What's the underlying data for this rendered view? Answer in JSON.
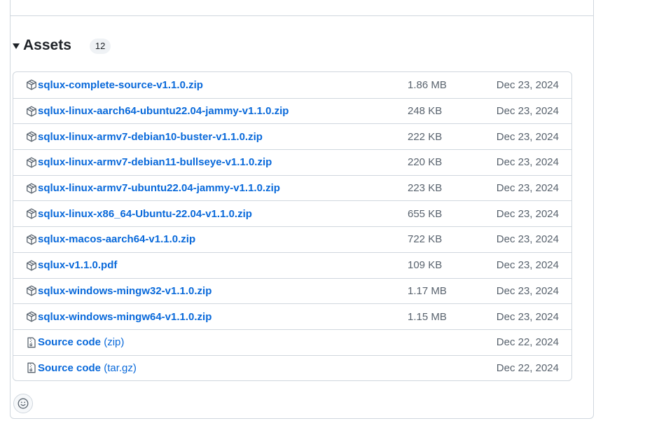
{
  "assets": {
    "title": "Assets",
    "count": "12",
    "items": [
      {
        "icon": "package-icon",
        "name": "sqlux-complete-source-v1.1.0.zip",
        "size": "1.86 MB",
        "date": "Dec 23, 2024"
      },
      {
        "icon": "package-icon",
        "name": "sqlux-linux-aarch64-ubuntu22.04-jammy-v1.1.0.zip",
        "size": "248 KB",
        "date": "Dec 23, 2024"
      },
      {
        "icon": "package-icon",
        "name": "sqlux-linux-armv7-debian10-buster-v1.1.0.zip",
        "size": "222 KB",
        "date": "Dec 23, 2024"
      },
      {
        "icon": "package-icon",
        "name": "sqlux-linux-armv7-debian11-bullseye-v1.1.0.zip",
        "size": "220 KB",
        "date": "Dec 23, 2024"
      },
      {
        "icon": "package-icon",
        "name": "sqlux-linux-armv7-ubuntu22.04-jammy-v1.1.0.zip",
        "size": "223 KB",
        "date": "Dec 23, 2024"
      },
      {
        "icon": "package-icon",
        "name": "sqlux-linux-x86_64-Ubuntu-22.04-v1.1.0.zip",
        "size": "655 KB",
        "date": "Dec 23, 2024"
      },
      {
        "icon": "package-icon",
        "name": "sqlux-macos-aarch64-v1.1.0.zip",
        "size": "722 KB",
        "date": "Dec 23, 2024"
      },
      {
        "icon": "package-icon",
        "name": "sqlux-v1.1.0.pdf",
        "size": "109 KB",
        "date": "Dec 23, 2024"
      },
      {
        "icon": "package-icon",
        "name": "sqlux-windows-mingw32-v1.1.0.zip",
        "size": "1.17 MB",
        "date": "Dec 23, 2024"
      },
      {
        "icon": "package-icon",
        "name": "sqlux-windows-mingw64-v1.1.0.zip",
        "size": "1.15 MB",
        "date": "Dec 23, 2024"
      },
      {
        "icon": "file-zip-icon",
        "name": "Source code",
        "paren": "(zip)",
        "size": "",
        "date": "Dec 22, 2024"
      },
      {
        "icon": "file-zip-icon",
        "name": "Source code",
        "paren": "(tar.gz)",
        "size": "",
        "date": "Dec 22, 2024"
      }
    ]
  },
  "reaction": {
    "icon": "smiley-icon"
  },
  "colors": {
    "link": "#0969da",
    "muted": "#59636e",
    "border": "#d0d7de"
  }
}
